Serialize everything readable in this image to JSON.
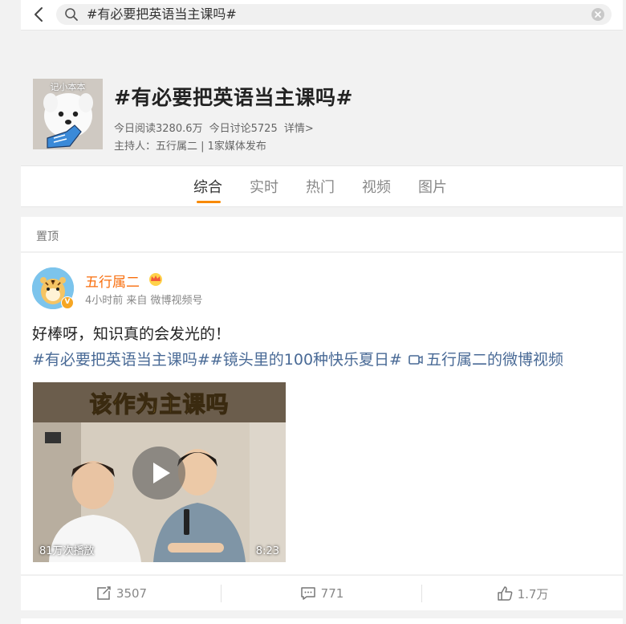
{
  "search": {
    "query": "#有必要把英语当主课吗#"
  },
  "topic": {
    "cover_label": "记小本本",
    "title": "#有必要把英语当主课吗#",
    "reads": "今日阅读3280.6万",
    "discussions": "今日讨论5725",
    "detail_link": "详情>",
    "host": "主持人：五行属二 | 1家媒体发布"
  },
  "tabs": [
    {
      "label": "综合",
      "active": true
    },
    {
      "label": "实时"
    },
    {
      "label": "热门"
    },
    {
      "label": "视频"
    },
    {
      "label": "图片"
    }
  ],
  "pinned_label": "置顶",
  "post": {
    "username": "五行属二",
    "meta": "4小时前 来自 微博视频号",
    "text": "好棒呀，知识真的会发光的！",
    "tags": [
      "#有必要把英语当主课吗#",
      "#镜头里的100种快乐夏日#"
    ],
    "video_link": "五行属二的微博视频",
    "video": {
      "title": "该作为主课吗",
      "play_count": "81万次播放",
      "duration": "8:23"
    }
  },
  "actions": {
    "repost": "3507",
    "comment": "771",
    "like": "1.7万"
  },
  "colors": {
    "accent": "#f88a00",
    "username": "#f86e0d",
    "link": "#496a96"
  }
}
